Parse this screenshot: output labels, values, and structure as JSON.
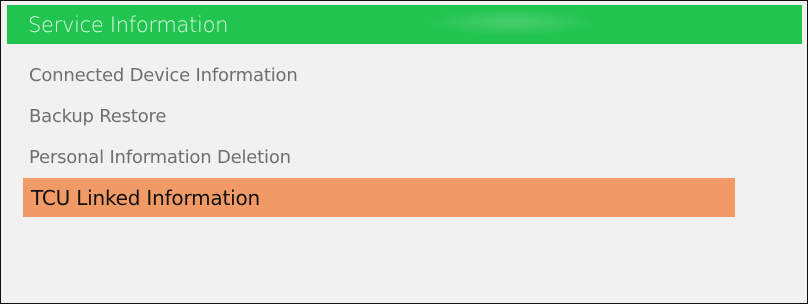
{
  "header": {
    "title": "Service Information",
    "color": "#22c450"
  },
  "menu": {
    "items": [
      {
        "label": "Connected Device Information",
        "selected": false
      },
      {
        "label": "Backup Restore",
        "selected": false
      },
      {
        "label": "Personal Information Deletion",
        "selected": false
      },
      {
        "label": "TCU Linked Information",
        "selected": true
      }
    ],
    "highlight_color": "#f29a66"
  }
}
